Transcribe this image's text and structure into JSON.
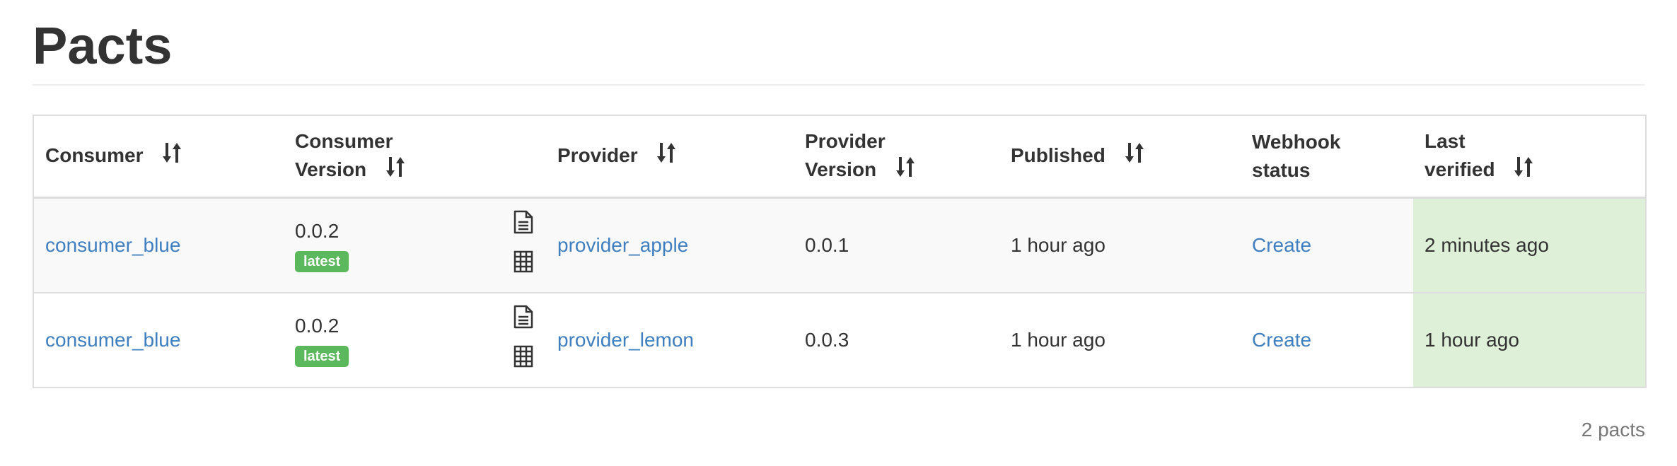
{
  "page": {
    "title": "Pacts",
    "count_label": "2 pacts"
  },
  "table": {
    "headers": {
      "consumer": "Consumer",
      "consumer_version": [
        "Consumer",
        "Version"
      ],
      "provider": "Provider",
      "provider_version": [
        "Provider",
        "Version"
      ],
      "published": "Published",
      "webhook_status": [
        "Webhook",
        "status"
      ],
      "last_verified": [
        "Last",
        "verified"
      ]
    },
    "rows": [
      {
        "consumer": "consumer_blue",
        "consumer_version": "0.0.2",
        "tag": "latest",
        "provider": "provider_apple",
        "provider_version": "0.0.1",
        "published": "1 hour ago",
        "webhook_status": "Create",
        "last_verified": "2 minutes ago"
      },
      {
        "consumer": "consumer_blue",
        "consumer_version": "0.0.2",
        "tag": "latest",
        "provider": "provider_lemon",
        "provider_version": "0.0.3",
        "published": "1 hour ago",
        "webhook_status": "Create",
        "last_verified": "1 hour ago"
      }
    ]
  },
  "icons": {
    "sort": "sort-arrows-icon",
    "document": "document-icon",
    "matrix": "table-grid-icon"
  },
  "colors": {
    "link": "#3f7fbf",
    "badge": "#5cb85c",
    "verified_bg": "#dff0d8",
    "stripe_bg": "#f9f9f9",
    "border": "#dddddd"
  }
}
